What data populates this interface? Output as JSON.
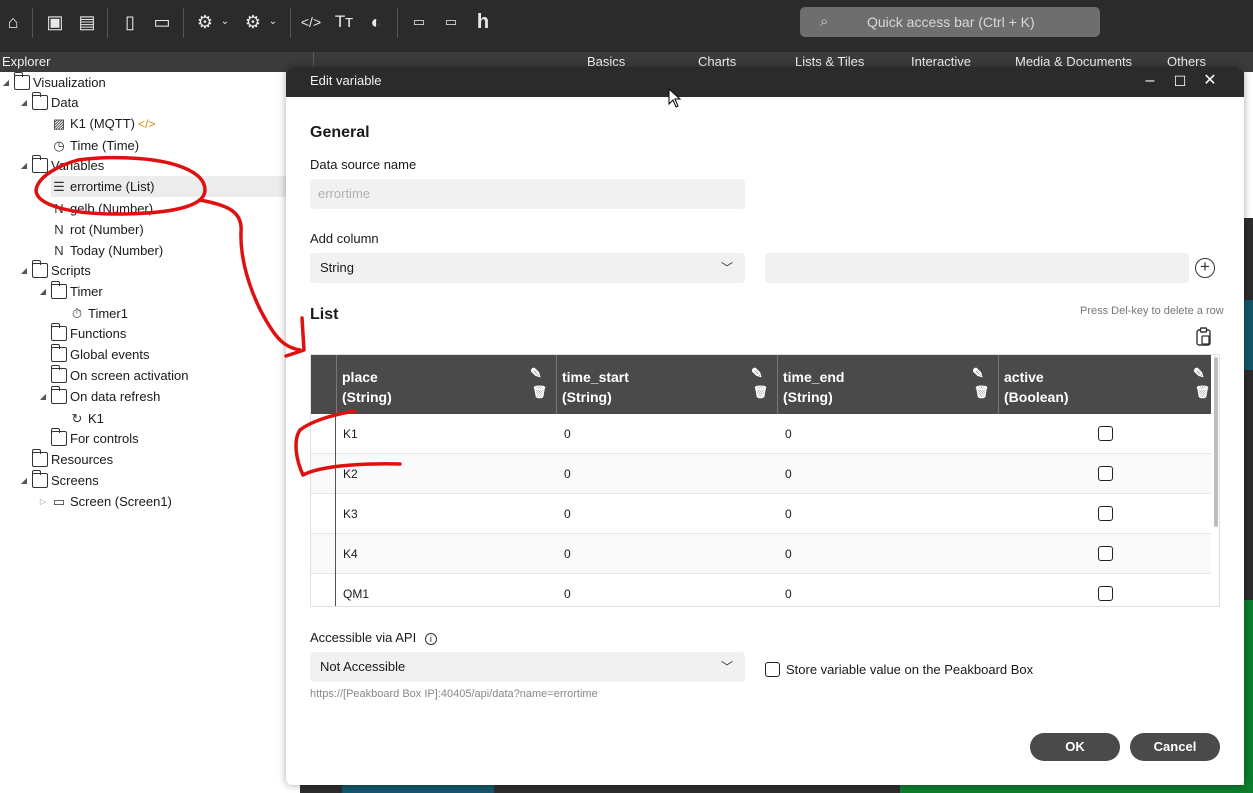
{
  "toolbar": {
    "icons": [
      "home-icon",
      "save-icon",
      "save-as-icon",
      "new-file-icon",
      "open-folder-icon",
      "settings-icon",
      "folder-settings-icon",
      "code-icon",
      "text-format-icon",
      "palette-icon",
      "peakboard-box-icon",
      "edge-icon",
      "hub-icon"
    ],
    "quick_access_placeholder": "Quick access bar (Ctrl + K)"
  },
  "explorer": {
    "title": "Explorer",
    "tree": [
      {
        "label": "Visualization"
      },
      {
        "label": "Data"
      },
      {
        "label": "K1 (MQTT)",
        "tag": "</>"
      },
      {
        "label": "Time (Time)"
      },
      {
        "label": "Variables"
      },
      {
        "label": "errortime (List)"
      },
      {
        "label": "gelb (Number)"
      },
      {
        "label": "rot (Number)"
      },
      {
        "label": "Today (Number)"
      },
      {
        "label": "Scripts"
      },
      {
        "label": "Timer"
      },
      {
        "label": "Timer1"
      },
      {
        "label": "Functions"
      },
      {
        "label": "Global events"
      },
      {
        "label": "On screen activation"
      },
      {
        "label": "On data refresh"
      },
      {
        "label": "K1"
      },
      {
        "label": "For controls"
      },
      {
        "label": "Resources"
      },
      {
        "label": "Screens"
      },
      {
        "label": "Screen (Screen1)"
      }
    ]
  },
  "categories": [
    "Basics",
    "Charts",
    "Lists & Tiles",
    "Interactive",
    "Media & Documents",
    "Others"
  ],
  "dialog": {
    "title": "Edit variable",
    "general_title": "General",
    "data_source_label": "Data source name",
    "data_source_value": "errortime",
    "add_column_label": "Add column",
    "add_column_type": "String",
    "list_title": "List",
    "del_hint": "Press Del-key to delete a row",
    "columns": [
      {
        "name": "place",
        "type": "(String)"
      },
      {
        "name": "time_start",
        "type": "(String)"
      },
      {
        "name": "time_end",
        "type": "(String)"
      },
      {
        "name": "active",
        "type": "(Boolean)"
      }
    ],
    "rows": [
      {
        "place": "K1",
        "time_start": "0",
        "time_end": "0",
        "active": false
      },
      {
        "place": "K2",
        "time_start": "0",
        "time_end": "0",
        "active": false
      },
      {
        "place": "K3",
        "time_start": "0",
        "time_end": "0",
        "active": false
      },
      {
        "place": "K4",
        "time_start": "0",
        "time_end": "0",
        "active": false
      },
      {
        "place": "QM1",
        "time_start": "0",
        "time_end": "0",
        "active": false
      }
    ],
    "api_label": "Accessible via API",
    "api_value": "Not Accessible",
    "store_label": "Store variable value on the Peakboard Box",
    "api_url": "https://[Peakboard Box IP]:40405/api/data?name=errortime",
    "ok_label": "OK",
    "cancel_label": "Cancel"
  },
  "annotation_color": "#e01010"
}
